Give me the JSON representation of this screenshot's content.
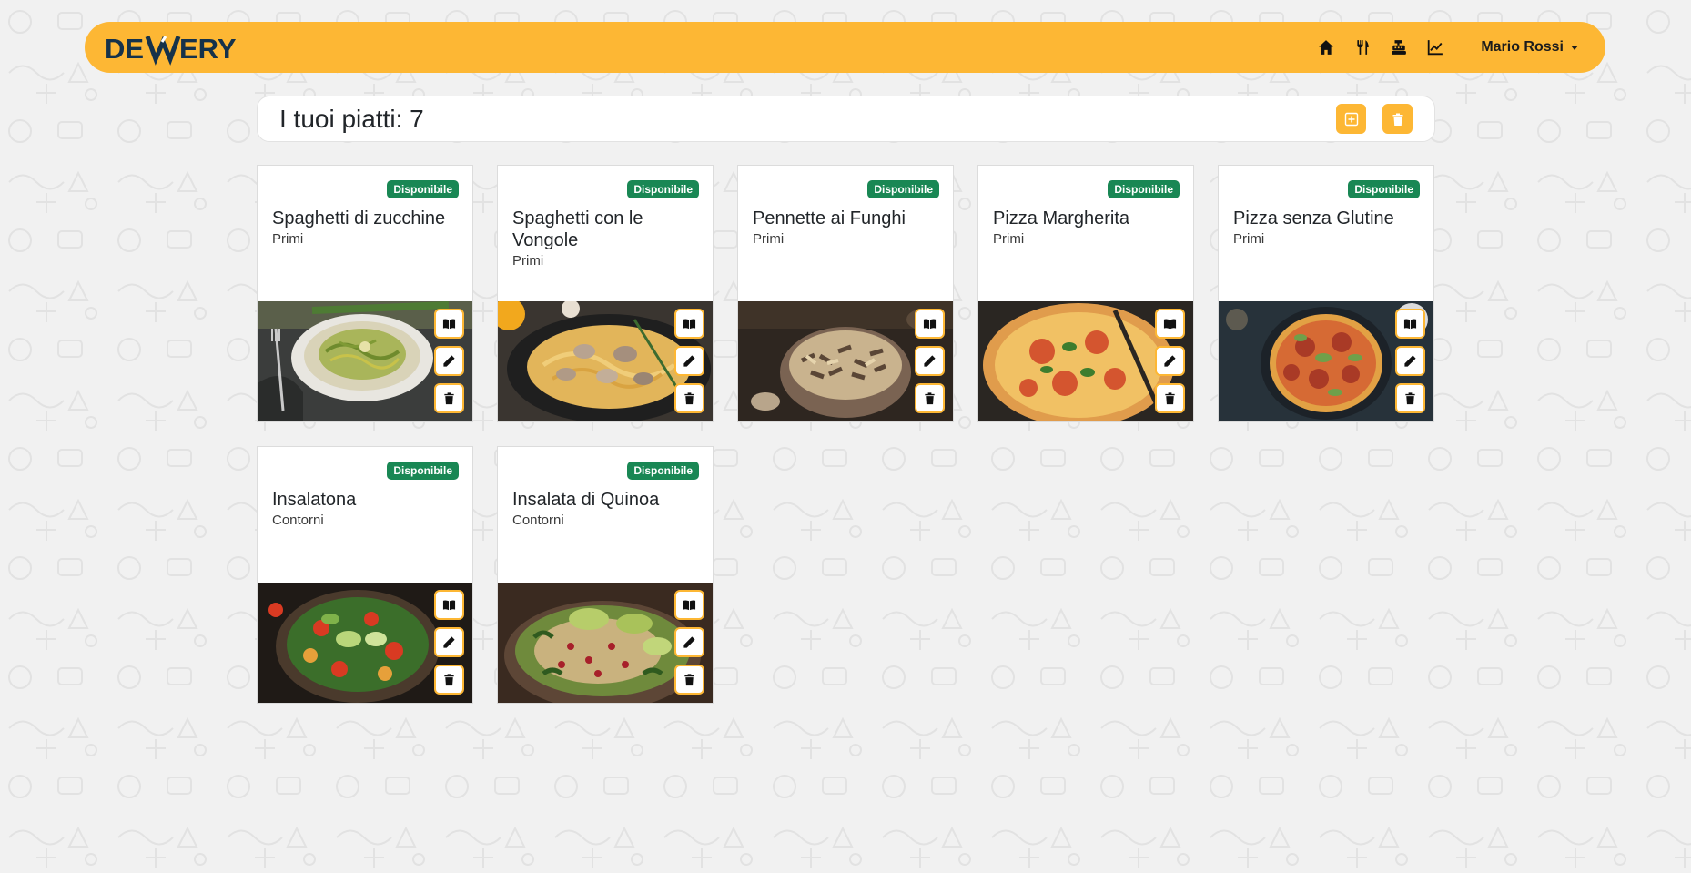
{
  "brand": {
    "name": "DEVVERY",
    "accent": "#fdb734"
  },
  "navbar": {
    "icons": [
      "home-icon",
      "utensils-icon",
      "cash-register-icon",
      "chart-line-icon"
    ],
    "user_name": "Mario Rossi"
  },
  "header": {
    "title": "I tuoi piatti: 7",
    "add_icon": "plus-square-icon",
    "delete_icon": "trash-icon"
  },
  "status_color": "#198754",
  "dishes": [
    {
      "name": "Spaghetti di zucchine",
      "category": "Primi",
      "status": "Disponibile",
      "image": "zucchini-spaghetti"
    },
    {
      "name": "Spaghetti con le Vongole",
      "category": "Primi",
      "status": "Disponibile",
      "image": "clam-spaghetti"
    },
    {
      "name": "Pennette ai Funghi",
      "category": "Primi",
      "status": "Disponibile",
      "image": "mushroom-penne"
    },
    {
      "name": "Pizza Margherita",
      "category": "Primi",
      "status": "Disponibile",
      "image": "pizza-margherita"
    },
    {
      "name": "Pizza senza Glutine",
      "category": "Primi",
      "status": "Disponibile",
      "image": "gluten-free-pizza"
    },
    {
      "name": "Insalatona",
      "category": "Contorni",
      "status": "Disponibile",
      "image": "salad"
    },
    {
      "name": "Insalata di Quinoa",
      "category": "Contorni",
      "status": "Disponibile",
      "image": "quinoa-salad"
    }
  ],
  "card_actions": [
    "book-icon",
    "pencil-icon",
    "trash-icon"
  ]
}
